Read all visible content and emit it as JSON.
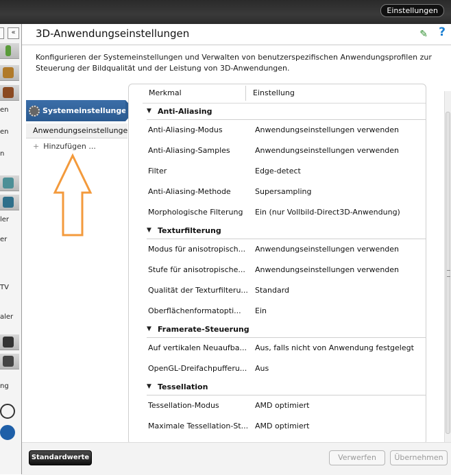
{
  "topbar": {
    "button": "Einstellungen"
  },
  "leftstrip": {
    "labels": [
      "en",
      "en",
      "n",
      "ler",
      "er",
      "TV",
      "aler",
      "ng"
    ]
  },
  "main": {
    "title": "3D-Anwendungseinstellungen",
    "description": "Konfigurieren der Systemeinstellungen und Verwalten von benutzerspezifischen Anwendungsprofilen zur Steuerung der Bildqualität und der Leistung von 3D-Anwendungen."
  },
  "subnav": {
    "selected": "Systemeinstellungen",
    "item": "Anwendungseinstellungen",
    "add": "Hinzufügen ..."
  },
  "table": {
    "headers": [
      "Merkmal",
      "Einstellung"
    ],
    "sections": [
      {
        "title": "Anti-Aliasing",
        "rows": [
          {
            "k": "Anti-Aliasing-Modus",
            "v": "Anwendungseinstellungen verwenden"
          },
          {
            "k": "Anti-Aliasing-Samples",
            "v": "Anwendungseinstellungen verwenden"
          },
          {
            "k": "Filter",
            "v": "Edge-detect"
          },
          {
            "k": "Anti-Aliasing-Methode",
            "v": "Supersampling"
          },
          {
            "k": "Morphologische Filterung",
            "v": "Ein (nur Vollbild-Direct3D-Anwendung)"
          }
        ]
      },
      {
        "title": "Texturfilterung",
        "rows": [
          {
            "k": "Modus für anisotropisch...",
            "v": "Anwendungseinstellungen verwenden"
          },
          {
            "k": "Stufe für anisotropische...",
            "v": "Anwendungseinstellungen verwenden"
          },
          {
            "k": "Qualität der Texturfilteru...",
            "v": "Standard"
          },
          {
            "k": "Oberflächenformatopti...",
            "v": "Ein"
          }
        ]
      },
      {
        "title": "Framerate-Steuerung",
        "rows": [
          {
            "k": "Auf vertikalen Neuaufba...",
            "v": "Aus, falls nicht von Anwendung festgelegt"
          },
          {
            "k": "OpenGL-Dreifachpufferu...",
            "v": "Aus"
          }
        ]
      },
      {
        "title": "Tessellation",
        "rows": [
          {
            "k": "Tessellation-Modus",
            "v": "AMD optimiert"
          },
          {
            "k": "Maximale Tessellation-St...",
            "v": "AMD optimiert"
          }
        ]
      }
    ]
  },
  "bottom": {
    "defaults": "Standardwerte",
    "discard": "Verwerfen",
    "apply": "Übernehmen"
  },
  "colors": {
    "accent": "#2b5a90",
    "arrow": "#f39a3c"
  }
}
